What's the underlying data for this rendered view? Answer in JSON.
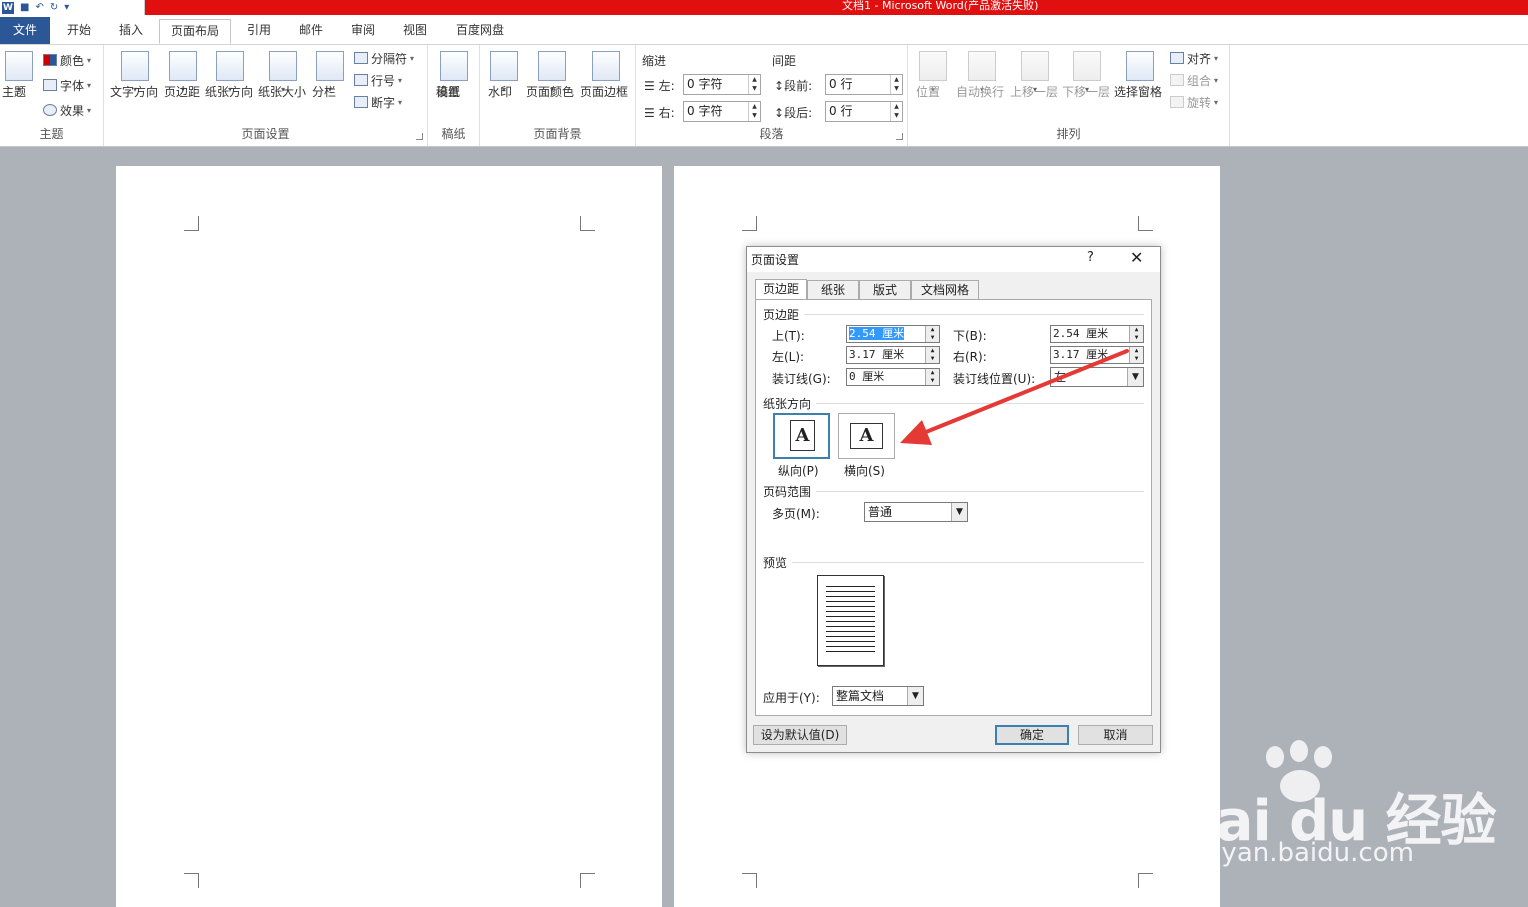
{
  "window": {
    "title": "文档1 - Microsoft Word(产品激活失败)"
  },
  "tabs": [
    {
      "label": "文件"
    },
    {
      "label": "开始"
    },
    {
      "label": "插入"
    },
    {
      "label": "页面布局"
    },
    {
      "label": "引用"
    },
    {
      "label": "邮件"
    },
    {
      "label": "审阅"
    },
    {
      "label": "视图"
    },
    {
      "label": "百度网盘"
    }
  ],
  "ribbon": {
    "theme_group": {
      "label": "主题",
      "themes": "主题",
      "colors": "颜色",
      "fonts": "字体",
      "effects": "效果"
    },
    "page_setup_group": {
      "label": "页面设置",
      "text_direction": "文字方向",
      "margins": "页边距",
      "orientation": "纸张方向",
      "size": "纸张大小",
      "columns": "分栏",
      "breaks": "分隔符",
      "line_numbers": "行号",
      "hyphenation": "断字"
    },
    "draft_group": {
      "label": "稿纸",
      "button_line1": "稿纸",
      "button_line2": "设置"
    },
    "background_group": {
      "label": "页面背景",
      "watermark": "水印",
      "page_color": "页面颜色",
      "page_borders": "页面边框"
    },
    "paragraph_group": {
      "label": "段落",
      "indent_title": "缩进",
      "spacing_title": "间距",
      "left_label": "左:",
      "left_value": "0 字符",
      "right_label": "右:",
      "right_value": "0 字符",
      "before_label": "段前:",
      "before_value": "0 行",
      "after_label": "段后:",
      "after_value": "0 行"
    },
    "arrange_group": {
      "label": "排列",
      "position": "位置",
      "wrap": "自动换行",
      "bring_forward": "上移一层",
      "send_backward": "下移一层",
      "selection_pane": "选择窗格",
      "align": "对齐",
      "group": "组合",
      "rotate": "旋转"
    }
  },
  "dialog": {
    "title": "页面设置",
    "help": "?",
    "close": "✕",
    "tabs": [
      {
        "label": "页边距"
      },
      {
        "label": "纸张"
      },
      {
        "label": "版式"
      },
      {
        "label": "文档网格"
      }
    ],
    "margins_section": "页边距",
    "top_label": "上(T):",
    "top_value": "2.54 厘米",
    "bottom_label": "下(B):",
    "bottom_value": "2.54 厘米",
    "left_label": "左(L):",
    "left_value": "3.17 厘米",
    "right_label": "右(R):",
    "right_value": "3.17 厘米",
    "gutter_label": "装订线(G):",
    "gutter_value": "0 厘米",
    "gutter_pos_label": "装订线位置(U):",
    "gutter_pos_value": "左",
    "orientation_section": "纸张方向",
    "portrait_label": "纵向(P)",
    "landscape_label": "横向(S)",
    "orient_glyph": "A",
    "pages_section": "页码范围",
    "multiple_pages_label": "多页(M):",
    "multiple_pages_value": "普通",
    "preview_section": "预览",
    "apply_to_label": "应用于(Y):",
    "apply_to_value": "整篇文档",
    "set_default": "设为默认值(D)",
    "ok": "确定",
    "cancel": "取消"
  },
  "watermark": {
    "logo": "Bai du 经验",
    "url": "jingyan.baidu.com"
  },
  "colors": {
    "title_bar": "#e01010",
    "file_tab": "#2b5797",
    "annotation_arrow": "#e53935",
    "workspace": "#adb1b8"
  }
}
